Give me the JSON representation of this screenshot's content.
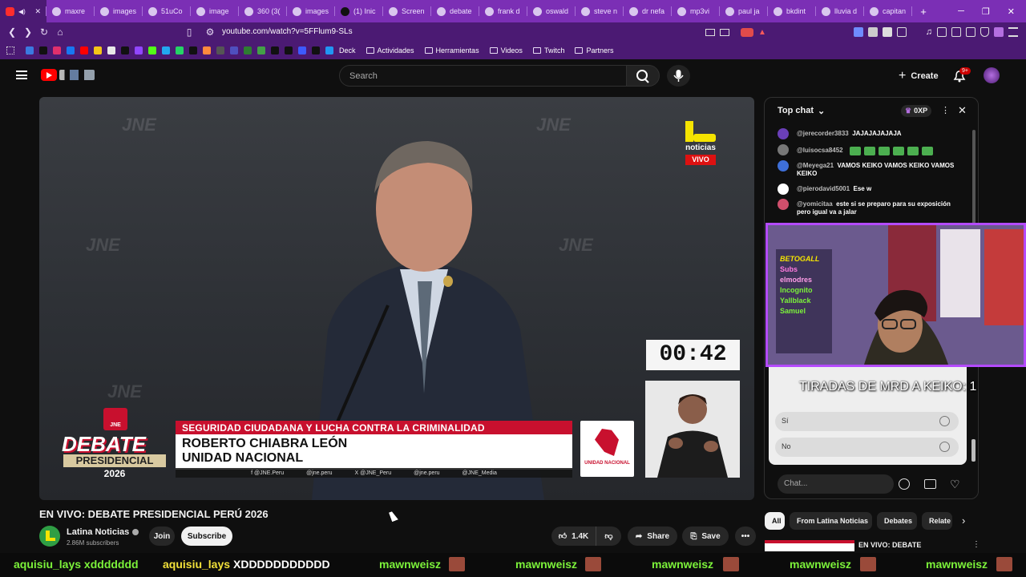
{
  "browser": {
    "tabs": [
      {
        "label": "",
        "active": true
      },
      {
        "label": "maxre"
      },
      {
        "label": "images"
      },
      {
        "label": "51uCo"
      },
      {
        "label": "image"
      },
      {
        "label": "360 (3("
      },
      {
        "label": "images"
      },
      {
        "label": "(1) Inic"
      },
      {
        "label": "Screen"
      },
      {
        "label": "debate"
      },
      {
        "label": "frank d"
      },
      {
        "label": "oswald"
      },
      {
        "label": "steve n"
      },
      {
        "label": "dr nefa"
      },
      {
        "label": "mp3vi"
      },
      {
        "label": "paul ja"
      },
      {
        "label": "bkdint"
      },
      {
        "label": "lluvia d"
      },
      {
        "label": "capitan"
      }
    ],
    "url": "youtube.com/watch?v=5FFlum9-SLs",
    "bookmarks": [
      "Deck",
      "Actividades",
      "Herramientas",
      "Videos",
      "Twitch",
      "Partners"
    ]
  },
  "youtube": {
    "search_placeholder": "Search",
    "create_label": "Create",
    "notif_badge": "9+"
  },
  "video": {
    "title": "EN VIVO: DEBATE PRESIDENCIAL PERÚ 2026",
    "timer": "00:42",
    "watermark": "JNE",
    "topic": "SEGURIDAD CIUDADANA Y LUCHA CONTRA LA CRIMINALIDAD",
    "speaker_name": "ROBERTO CHIABRA LEÓN",
    "speaker_party": "UNIDAD NACIONAL",
    "debate_word": "DEBATE",
    "presidencial": "PRESIDENCIAL",
    "year": "2026",
    "jne_badge": "JNE",
    "party_logo_label": "UNIDAD NACIONAL",
    "socials": [
      "f @JNE.Peru",
      "@jne.peru",
      "X @JNE_Peru",
      "@jne.peru",
      "@JNE_Media"
    ],
    "channel_logo": {
      "line1": "noticias",
      "line2": "VIVO"
    }
  },
  "channel": {
    "name": "Latina Noticias",
    "subscribers": "2.86M subscribers",
    "join_label": "Join",
    "subscribe_label": "Subscribe",
    "likes": "1.4K",
    "share_label": "Share",
    "save_label": "Save"
  },
  "chat": {
    "header": "Top chat",
    "xp_label": "0XP",
    "messages": [
      {
        "user": "@jerecorder3833",
        "text": "JAJAJAJAJAJA",
        "color": "#6a3fb8"
      },
      {
        "user": "@luisocsa8452",
        "text": "",
        "color": "#777777"
      },
      {
        "user": "@Meyega21",
        "text": "VAMOS KEIKO VAMOS KEIKO VAMOS KEIKO",
        "color": "#3e6fd8"
      },
      {
        "user": "@pierodavid5001",
        "text": "Ese w",
        "color": "#ffffff"
      },
      {
        "user": "@yomicitaa",
        "text": "este si se preparo para su exposición pero igual va a jalar",
        "color": "#d04f6c"
      }
    ],
    "overlay_text": "TIRADAS DE MRD A KEIKO: 1",
    "poll_options": [
      "Sí",
      "No"
    ],
    "input_placeholder": "Chat...",
    "cam_lines": [
      "BETOGALL",
      "Subs",
      "elmodres",
      "Incognito",
      "Yallblack",
      "Samuel"
    ]
  },
  "chips": [
    "All",
    "From Latina Noticias",
    "Debates",
    "Relate"
  ],
  "related": {
    "title": "EN VIVO: DEBATE"
  },
  "ticker": [
    {
      "text": "aquisiu_lays xddddddd",
      "color": "#7cf23a"
    },
    {
      "text": "aquisiu_lays",
      "color": "#f2e13a"
    },
    {
      "text": "XDDDDDDDDDDD",
      "color": "#ffffff"
    },
    {
      "text": "mawnweisz",
      "color": "#7cf23a"
    },
    {
      "text": "mawnweisz",
      "color": "#7cf23a"
    },
    {
      "text": "mawnweisz",
      "color": "#7cf23a"
    },
    {
      "text": "mawnweisz",
      "color": "#7cf23a"
    },
    {
      "text": "mawnweisz",
      "color": "#7cf23a"
    }
  ]
}
